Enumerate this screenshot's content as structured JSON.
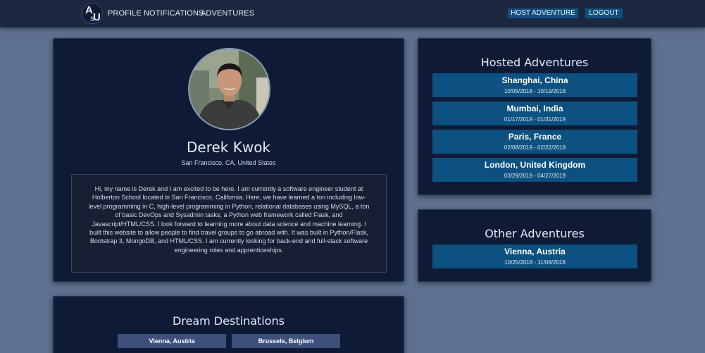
{
  "nav": {
    "logo_a": "A",
    "logo_u": "U",
    "logo_s": "S",
    "links": [
      "PROFILE",
      "NOTIFICATIONS",
      "ADVENTURES"
    ],
    "host_label": "HOST ADVENTURE",
    "logout_label": "LOGOUT"
  },
  "profile": {
    "name": "Derek Kwok",
    "location": "San Francisco, CA, United States",
    "bio": "Hi, my name is Derek and I am excited to be here. I am currently a software engineer student at Holberton School located in San Francisco, California. Here, we have learned a ton including low-level programming in C, high-level programming in Python, relational databases using MySQL, a ton of basic DevOps and Sysadmin tasks, a Python web framework called Flask, and Javascript/HTML/CSS. I look forward to learning more about data science and machine learning. I built this website to allow people to find travel groups to go abroad with. It was built in Python/Flask, Bootstrap 3, MongoDB, and HTML/CSS. I am currently looking for back-end and full-stack software engineering roles and apprenticeships."
  },
  "hosted": {
    "title": "Hosted Adventures",
    "items": [
      {
        "city": "Shanghai, China",
        "dates": "10/05/2018 - 10/19/2018"
      },
      {
        "city": "Mumbai, India",
        "dates": "01/17/2019 - 01/31/2019"
      },
      {
        "city": "Paris, France",
        "dates": "02/08/2019 - 02/22/2019"
      },
      {
        "city": "London, United Kingdom",
        "dates": "03/29/2019 - 04/27/2019"
      }
    ]
  },
  "other": {
    "title": "Other Adventures",
    "items": [
      {
        "city": "Vienna, Austria",
        "dates": "10/25/2018 - 11/08/2018"
      }
    ]
  },
  "dream": {
    "title": "Dream Destinations",
    "items": [
      "Vienna, Austria",
      "Brussels, Belgium"
    ]
  },
  "colors": {
    "page_bg": "#5f7190",
    "navbar": "#1c2740",
    "panel": "#0e1a36",
    "adventure_tile": "#0c5180",
    "dream_tag": "#3d4f7a"
  },
  "icons": {
    "logo": "aus-logo",
    "avatar": "profile-photo"
  }
}
